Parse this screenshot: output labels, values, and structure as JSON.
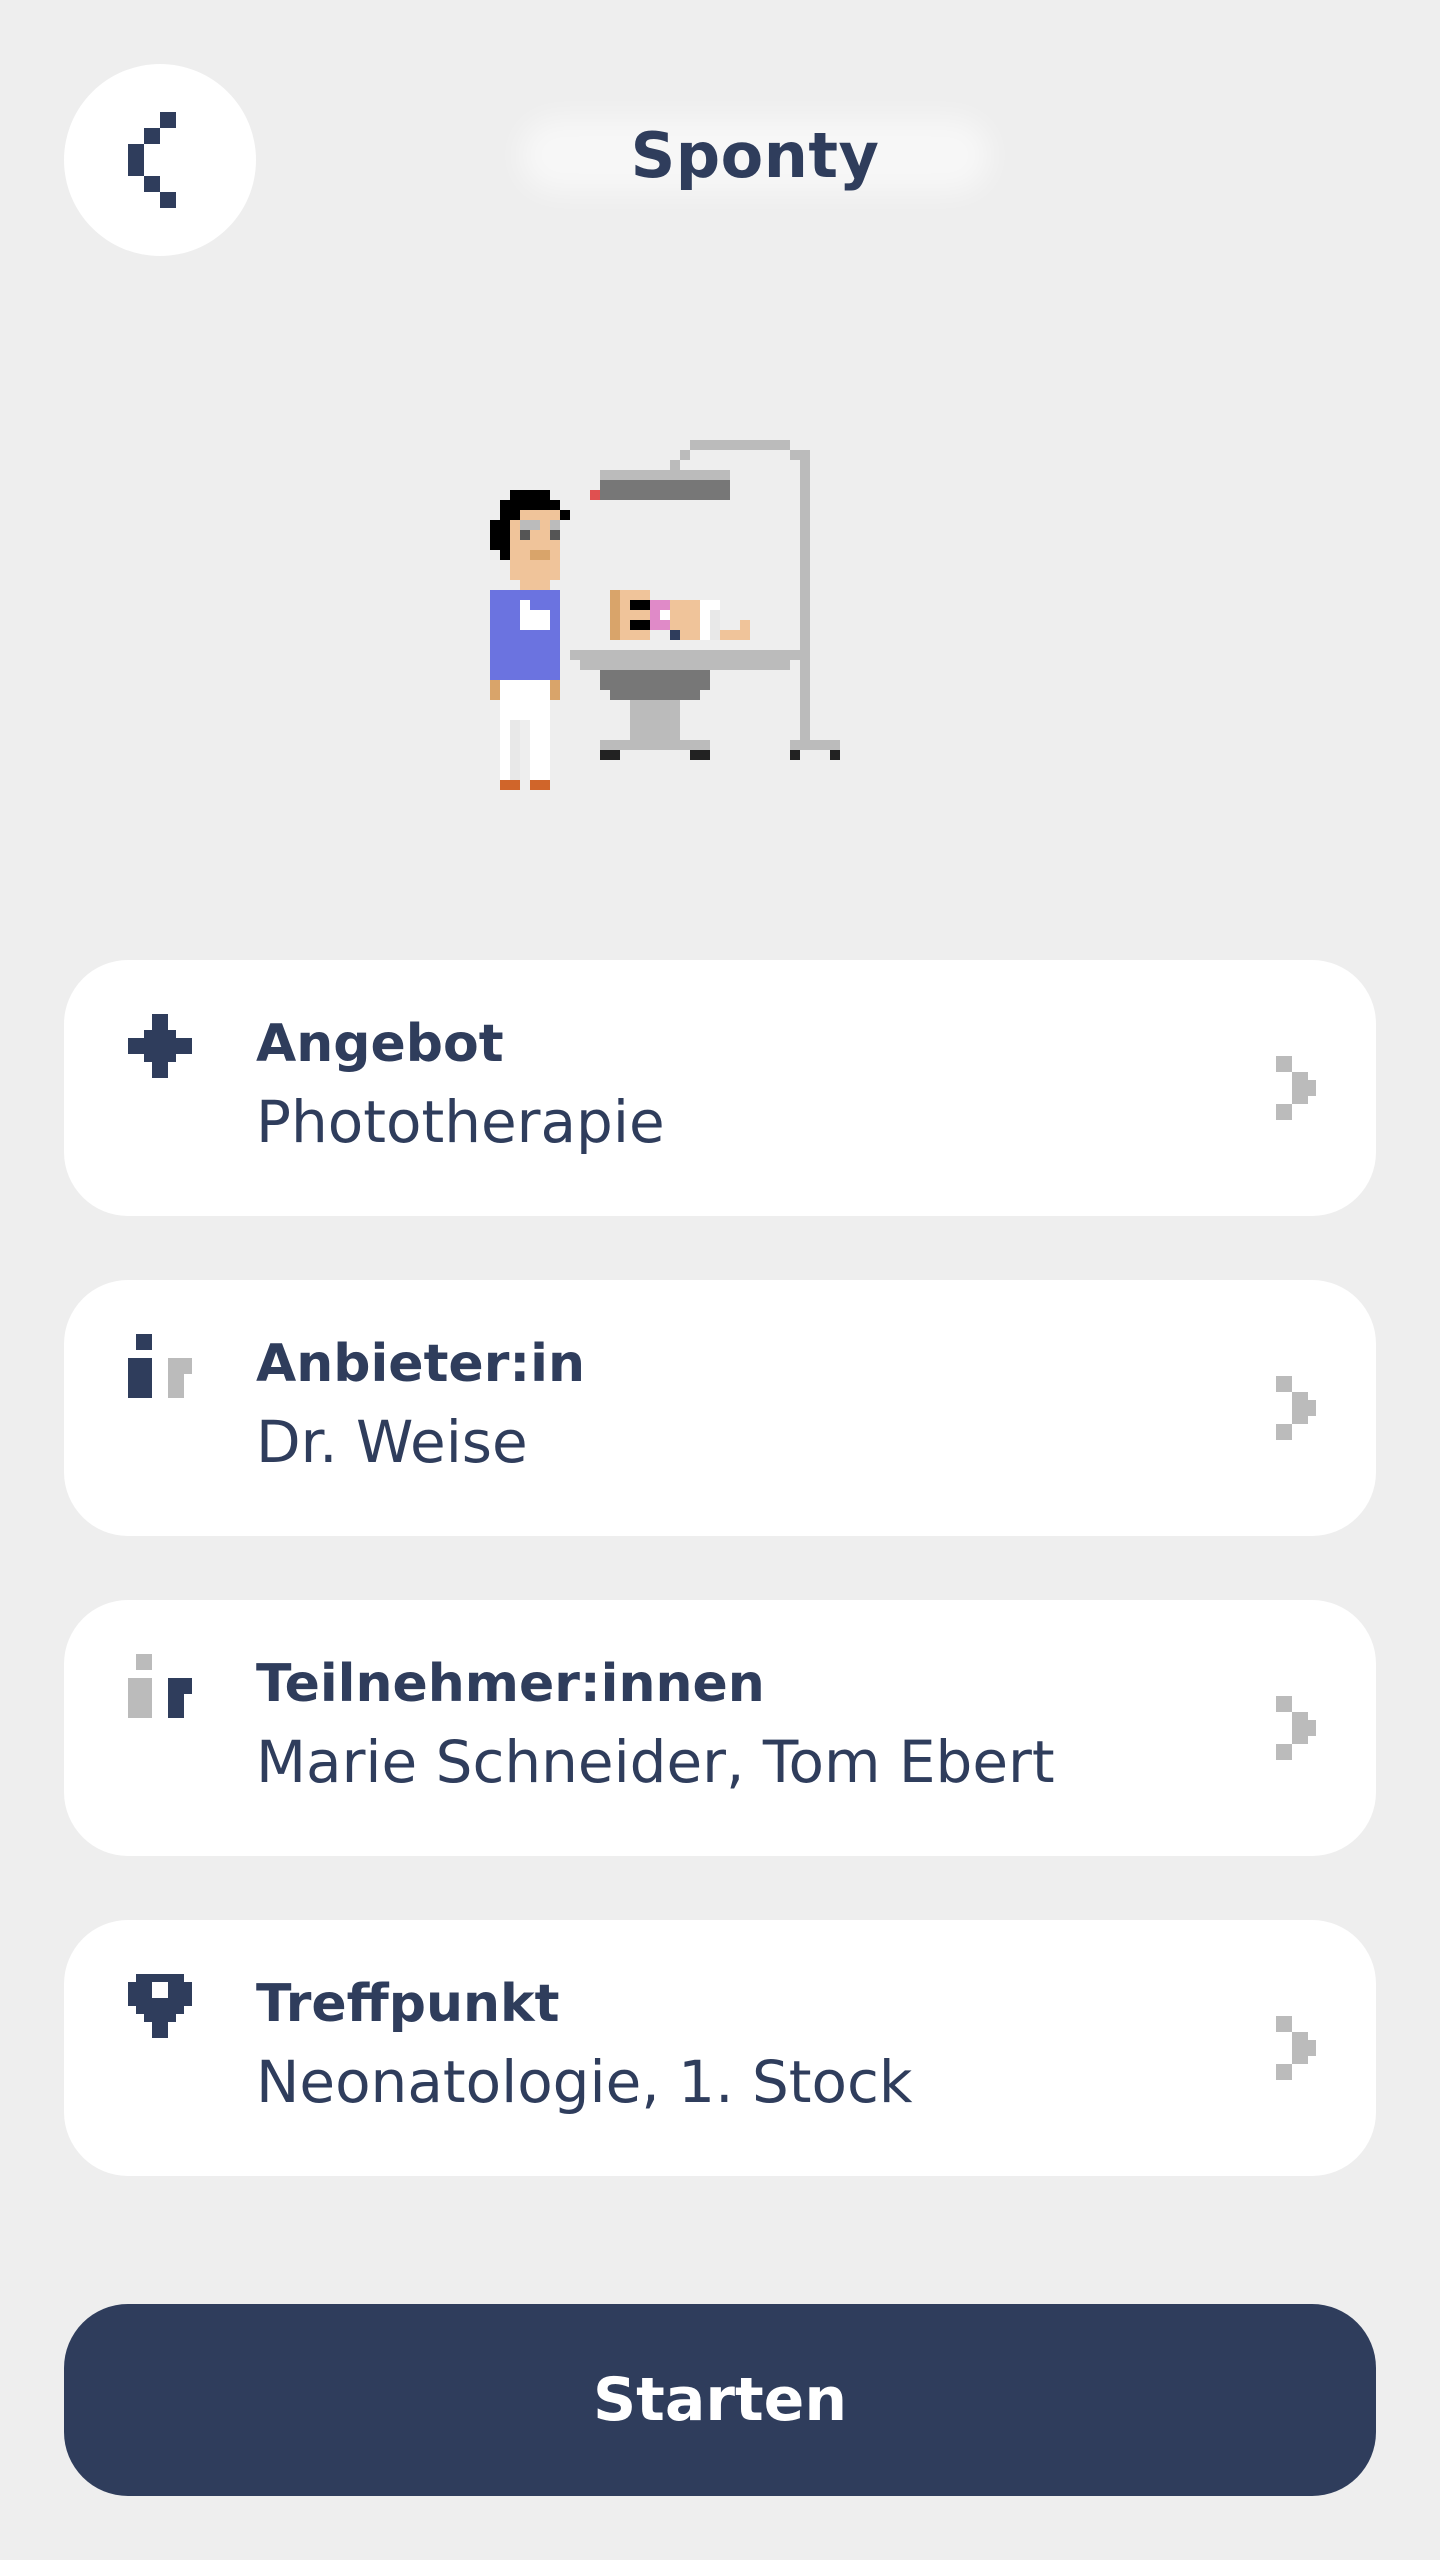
{
  "header": {
    "title": "Sponty",
    "back_icon": "share-icon"
  },
  "cards": [
    {
      "icon": "sparkle-plus-icon",
      "label": "Angebot",
      "value": "Phototherapie"
    },
    {
      "icon": "person-i-icon",
      "label": "Anbieter:in",
      "value": "Dr. Weise"
    },
    {
      "icon": "participants-icon",
      "label": "Teilnehmer:innen",
      "value": "Marie Schneider, Tom Ebert"
    },
    {
      "icon": "location-pin-icon",
      "label": "Treffpunkt",
      "value": "Neonatologie, 1. Stock"
    }
  ],
  "start_button": {
    "label": "Starten"
  },
  "colors": {
    "primary": "#2f3d5c",
    "background": "#eeeeee",
    "card": "#ffffff",
    "muted": "#bbbbbb"
  }
}
